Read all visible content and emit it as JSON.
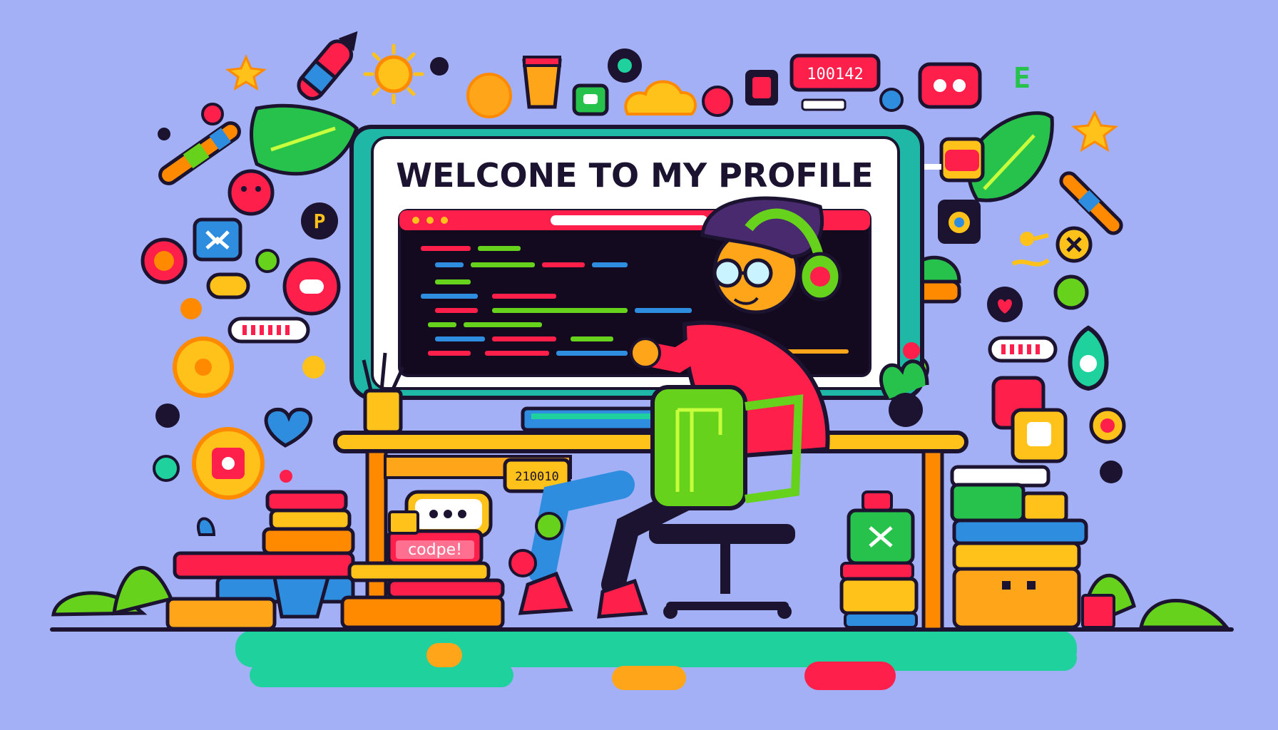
{
  "monitor": {
    "title": "WELCONE TO MY PROFILE"
  },
  "badges": {
    "top_counter": "100142",
    "desk_counter": "210010",
    "book_label": "codpe!"
  },
  "colors": {
    "background": "#a3b0f5",
    "accent_red": "#ff1f4b",
    "accent_green": "#66d21c",
    "accent_yellow": "#ffc21a",
    "accent_blue": "#2f8de0",
    "accent_teal": "#1fd19c",
    "outline": "#1b1330"
  },
  "icons": [
    "rocket-icon",
    "sun-icon",
    "coin-icon",
    "cup-icon",
    "cloud-icon",
    "note-icon",
    "chat-bubble-icon",
    "leaf-icon",
    "star-icon",
    "camera-icon",
    "heart-icon",
    "ellipsis-chat-icon",
    "pencil-cup-icon",
    "plant-icon",
    "headphones-icon",
    "hat-icon",
    "bookshelf-icon",
    "chair-icon",
    "keyboard-icon"
  ]
}
